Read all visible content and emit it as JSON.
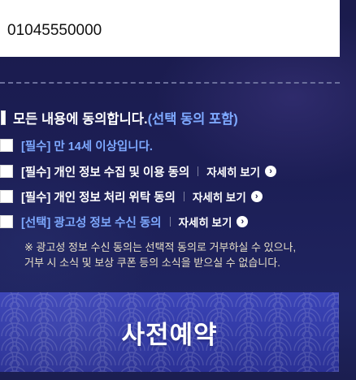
{
  "phone": {
    "value": "01045550000"
  },
  "agreements": {
    "all": {
      "label": "모든 내용에 동의합니다.",
      "note": "(선택 동의 포함)"
    },
    "items": [
      {
        "label": "[필수] 만 14세 이상입니다.",
        "detail": ""
      },
      {
        "label": "[필수] 개인 정보 수집 및 이용 동의",
        "detail": "자세히 보기"
      },
      {
        "label": "[필수] 개인 정보 처리 위탁 동의",
        "detail": "자세히 보기"
      },
      {
        "label": "[선택] 광고성 정보 수신 동의",
        "detail": "자세히 보기"
      }
    ],
    "notice": [
      "※ 광고성 정보 수신 동의는 선택적 동의로 거부하실 수 있으나,",
      "거부 시 소식 및 보상 쿠폰 등의 소식을 받으실 수 없습니다."
    ]
  },
  "submit": {
    "label": "사전예약"
  },
  "icons": {
    "detail_arrow": "chevron-right-icon",
    "checkbox": "checkbox-icon"
  },
  "colors": {
    "background": "#1c1e55",
    "accent_blue": "#7ea9ff",
    "button": "#3a42b5",
    "notice_text": "#e8e0c8"
  }
}
